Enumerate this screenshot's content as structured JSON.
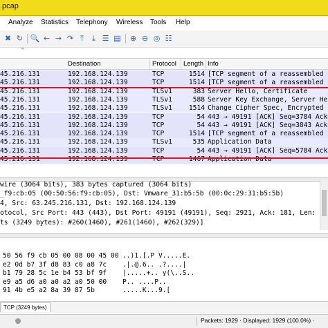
{
  "window": {
    "title": ".pcap"
  },
  "menu": [
    "Analyze",
    "Statistics",
    "Telephony",
    "Wireless",
    "Tools",
    "Help"
  ],
  "toolbar_icons": [
    "start-capture-icon",
    "stop-capture-icon",
    "restart-capture-icon",
    "capture-options-icon",
    "open-file-icon",
    "save-file-icon",
    "close-file-icon",
    "reload-icon",
    "find-packet-icon",
    "go-back-icon",
    "go-forward-icon",
    "go-to-packet-icon",
    "first-packet-icon",
    "last-packet-icon",
    "autoscroll-icon",
    "colorize-icon",
    "zoom-in-icon",
    "zoom-out-icon",
    "normal-size-icon",
    "resize-columns-icon"
  ],
  "packet_list": {
    "columns": [
      "Destination",
      "Protocol",
      "Length",
      "Info"
    ],
    "rows": [
      {
        "source": "45.216.131",
        "destination": "192.168.124.139",
        "protocol": "TCP",
        "length": "1514",
        "info": "[TCP segment of a reassembled",
        "kind": "tcp"
      },
      {
        "source": "45.216.131",
        "destination": "192.168.124.139",
        "protocol": "TCP",
        "length": "1514",
        "info": "[TCP segment of a reassembled",
        "kind": "tcp"
      },
      {
        "source": "45.216.131",
        "destination": "192.168.124.139",
        "protocol": "TLSv1",
        "length": "383",
        "info": "Server Hello, Certificate",
        "kind": "tls"
      },
      {
        "source": "45.216.131",
        "destination": "192.168.124.139",
        "protocol": "TLSv1",
        "length": "588",
        "info": "Server Key Exchange, Server He",
        "kind": "tls"
      },
      {
        "source": "45.216.131",
        "destination": "192.168.124.139",
        "protocol": "TLSv1",
        "length": "1514",
        "info": "Change Cipher Spec, Encrypted",
        "kind": "tls"
      },
      {
        "source": "45.216.131",
        "destination": "192.168.124.139",
        "protocol": "TCP",
        "length": "54",
        "info": "443 → 49191 [ACK] Seq=3784 Ack",
        "kind": "tcp"
      },
      {
        "source": "45.216.131",
        "destination": "192.168.124.139",
        "protocol": "TCP",
        "length": "54",
        "info": "443 → 49191 [ACK] Seq=3843 Ack",
        "kind": "tcp"
      },
      {
        "source": "45.216.131",
        "destination": "192.168.124.139",
        "protocol": "TCP",
        "length": "1514",
        "info": "[TCP segment of a reassembled",
        "kind": "tcp"
      },
      {
        "source": "45.216.131",
        "destination": "192.168.124.139",
        "protocol": "TLSv1",
        "length": "535",
        "info": "Application Data",
        "kind": "tls"
      },
      {
        "source": "45.216.131",
        "destination": "192.168.124.139",
        "protocol": "TCP",
        "length": "54",
        "info": "443 → 49191 [ACK] Seq=5784 Ack",
        "kind": "tcp"
      },
      {
        "source": "45.216.131",
        "destination": "192.168.124.139",
        "protocol": "TCP",
        "length": "1467",
        "info": "Application Data",
        "kind": "tcp"
      }
    ]
  },
  "details": [
    "wire (3064 bits), 383 bytes captured (3064 bits)",
    "_f9:cb:05 (00:50:56:f9:cb:05), Dst: Vmware_31:b5:5b (00:0c:29:31:b5:5b)",
    "4, Src: 63.245.216.131, Dst: 192.168.124.139",
    "otocol, Src Port: 443 (443), Dst Port: 49191 (49191), Seq: 2921, Ack: 181, Len: 329",
    "ts (3249 bytes): #260(1460), #261(1460), #262(329)]"
  ],
  "bytes": [
    {
      "hex": "50  56 f9 cb 05 00 08 00 45 00",
      "ascii": "..)1.[.P V.....E."
    },
    {
      "hex": "e2  0d b7 3f d8 83 c0 a8 7c",
      "ascii": ".|.@.6.. .?....|"
    },
    {
      "hex": "b1  79 28 5c 1e b4 53 bf 9f",
      "ascii": "|.....+.. y(\\..S.."
    },
    {
      "hex": "e9  a5 d6 a0 a0 a2 a0 50 00",
      "ascii": "P.. ....P.."
    },
    {
      "hex": "91  4b e5 a2 8a 39 87 5b",
      "ascii": ".....K...9.["
    }
  ],
  "bytes_tab": "TCP (3249 bytes)",
  "status": {
    "packets": "Packets: 1929 · Displayed: 1929 (100.0%) ·"
  }
}
